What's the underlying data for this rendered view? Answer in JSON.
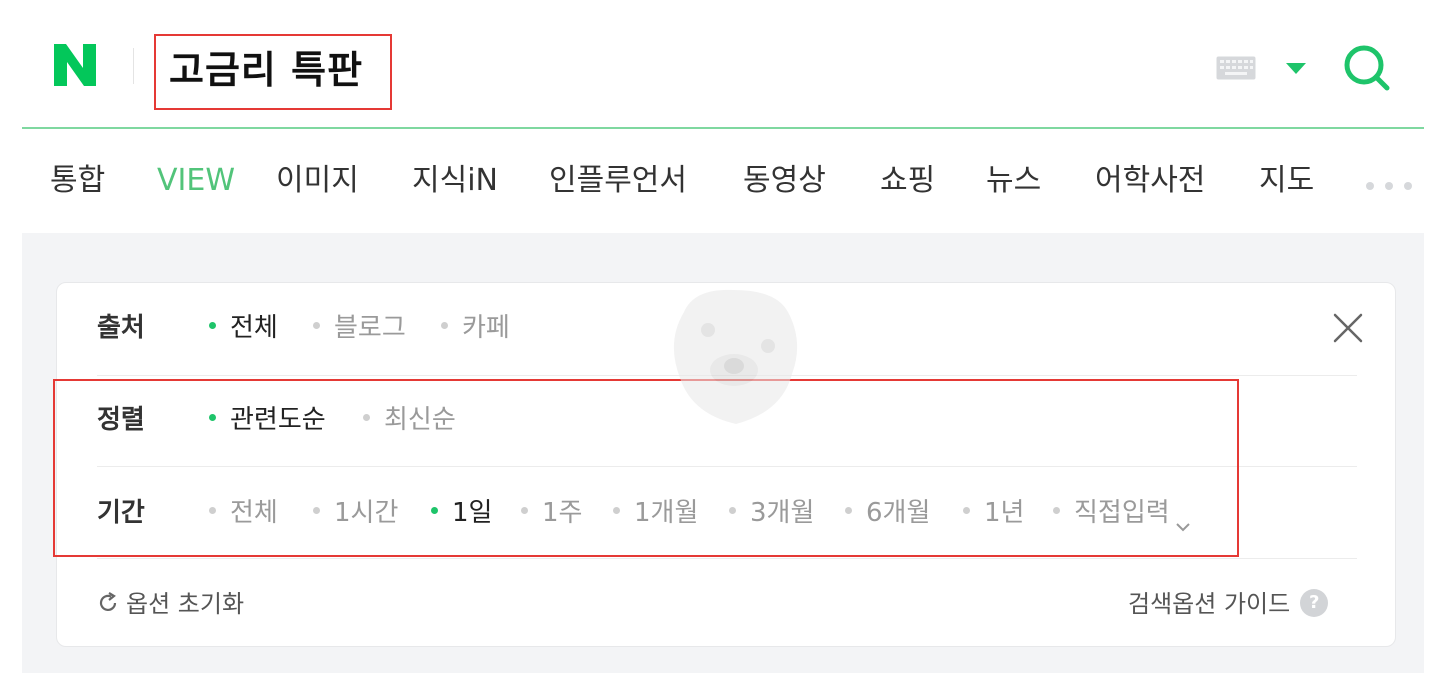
{
  "search": {
    "query": "고금리 특판"
  },
  "tabs": [
    {
      "label": "통합",
      "active": false
    },
    {
      "label": "VIEW",
      "active": true
    },
    {
      "label": "이미지",
      "active": false
    },
    {
      "label": "지식iN",
      "active": false
    },
    {
      "label": "인플루언서",
      "active": false
    },
    {
      "label": "동영상",
      "active": false
    },
    {
      "label": "쇼핑",
      "active": false
    },
    {
      "label": "뉴스",
      "active": false
    },
    {
      "label": "어학사전",
      "active": false
    },
    {
      "label": "지도",
      "active": false
    }
  ],
  "options": {
    "source": {
      "label": "출처",
      "items": [
        "전체",
        "블로그",
        "카페"
      ],
      "selected": "전체"
    },
    "sort": {
      "label": "정렬",
      "items": [
        "관련도순",
        "최신순"
      ],
      "selected": "관련도순"
    },
    "period": {
      "label": "기간",
      "items": [
        "전체",
        "1시간",
        "1일",
        "1주",
        "1개월",
        "3개월",
        "6개월",
        "1년",
        "직접입력"
      ],
      "selected": "1일"
    },
    "reset_label": "옵션 초기화",
    "guide_label": "검색옵션 가이드",
    "help_glyph": "?"
  },
  "colors": {
    "brand_green": "#1ec46a",
    "active_tab": "#52c47a",
    "highlight_box": "#e53935"
  },
  "icons": [
    "naver-logo-icon",
    "keyboard-icon",
    "dropdown-triangle-icon",
    "search-icon",
    "more-dots-icon",
    "close-icon",
    "refresh-icon",
    "chevron-down-icon",
    "help-icon"
  ]
}
